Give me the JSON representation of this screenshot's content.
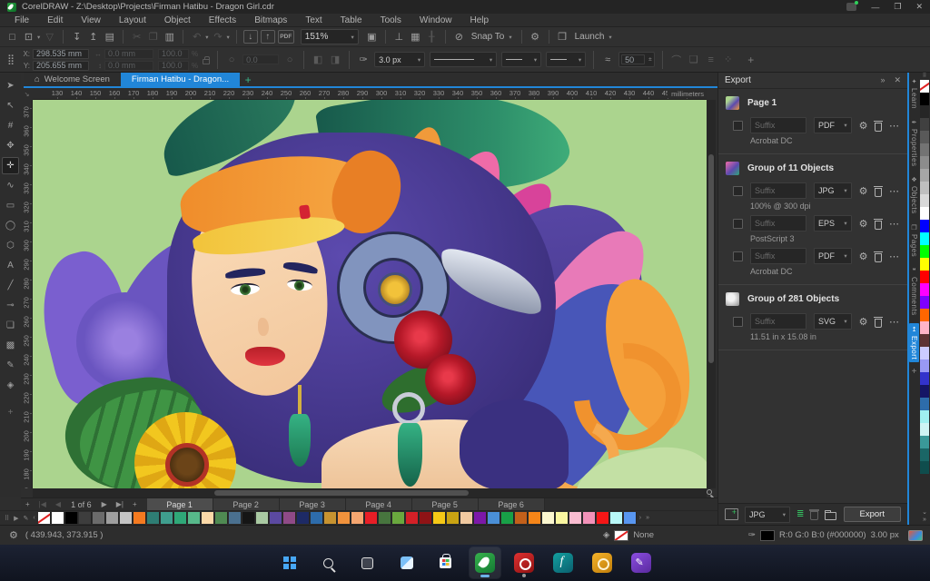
{
  "window": {
    "title": "CorelDRAW - Z:\\Desktop\\Projects\\Firman Hatibu - Dragon Girl.cdr",
    "controls": {
      "minimize": "—",
      "restore": "❐",
      "close": "✕"
    }
  },
  "menu": {
    "items": [
      "File",
      "Edit",
      "View",
      "Layout",
      "Object",
      "Effects",
      "Bitmaps",
      "Text",
      "Table",
      "Tools",
      "Window",
      "Help"
    ]
  },
  "toolbar": {
    "zoom_level": "151%",
    "items": [
      {
        "t": "icon",
        "name": "new-document-icon",
        "g": "□"
      },
      {
        "t": "icon",
        "name": "open-icon",
        "g": "⊡",
        "dd": true
      },
      {
        "t": "icon",
        "name": "save-icon",
        "g": "▽",
        "off": true
      },
      {
        "t": "sep"
      },
      {
        "t": "icon",
        "name": "get-more-download-icon",
        "g": "↧"
      },
      {
        "t": "icon",
        "name": "share-upload-icon",
        "g": "↥"
      },
      {
        "t": "icon",
        "name": "print-icon",
        "g": "▤"
      },
      {
        "t": "sep"
      },
      {
        "t": "icon",
        "name": "cut-icon",
        "g": "✂",
        "off": true
      },
      {
        "t": "icon",
        "name": "copy-icon",
        "g": "❐",
        "off": true
      },
      {
        "t": "icon",
        "name": "paste-icon",
        "g": "▥"
      },
      {
        "t": "sep"
      },
      {
        "t": "icon",
        "name": "undo-icon",
        "g": "↶",
        "off": true,
        "dd": true
      },
      {
        "t": "icon",
        "name": "redo-icon",
        "g": "↷",
        "off": true,
        "dd": true
      },
      {
        "t": "sep"
      },
      {
        "t": "icon",
        "name": "import-icon",
        "g": "↓",
        "box": true
      },
      {
        "t": "icon",
        "name": "export-icon",
        "g": "↑",
        "box": true
      },
      {
        "t": "icon",
        "name": "publish-pdf-icon",
        "g": "PDF",
        "pdf": true
      },
      {
        "t": "zoom"
      },
      {
        "t": "icon",
        "name": "fullscreen-preview-icon",
        "g": "▣"
      },
      {
        "t": "sep"
      },
      {
        "t": "icon",
        "name": "show-rulers-icon",
        "g": "⊥"
      },
      {
        "t": "icon",
        "name": "show-grid-icon",
        "g": "▦"
      },
      {
        "t": "icon",
        "name": "show-guidelines-icon",
        "g": "╂",
        "off": true
      },
      {
        "t": "sep"
      },
      {
        "t": "icon",
        "name": "snap-off-icon",
        "g": "⊘"
      },
      {
        "t": "label",
        "name": "snap-to-dropdown",
        "label": "Snap To",
        "dd": true
      },
      {
        "t": "sep"
      },
      {
        "t": "icon",
        "name": "options-gear-icon",
        "g": "⚙"
      },
      {
        "t": "sep"
      },
      {
        "t": "icon",
        "name": "launch-window-icon",
        "g": "❒"
      },
      {
        "t": "label",
        "name": "launch-dropdown",
        "label": "Launch",
        "dd": true
      }
    ]
  },
  "property_bar": {
    "x_label": "X:",
    "y_label": "Y:",
    "x": "298.535 mm",
    "y": "205.655 mm",
    "width": "0.0 mm",
    "height": "0.0 mm",
    "scale_x": "100.0",
    "scale_y": "100.0",
    "percent": "%",
    "angle": "0.0",
    "outline_width": "3.0 px",
    "smooth_steps": "50"
  },
  "document_tabs": {
    "welcome": "Welcome Screen",
    "active": "Firman Hatibu - Dragon...",
    "new_tab": "+",
    "home_icon": "⌂"
  },
  "rulers": {
    "unit": "millimeters",
    "h_start": 130,
    "h_end": 460,
    "v_start": 370,
    "v_end": 170,
    "step": 10
  },
  "toolbox": {
    "tools": [
      {
        "name": "pick-tool",
        "g": "➤"
      },
      {
        "name": "shape-tool",
        "g": "↖"
      },
      {
        "name": "crop-tool",
        "g": "#"
      },
      {
        "name": "pan-tool",
        "g": "✥"
      },
      {
        "name": "freehand-pick-tool",
        "g": "✛",
        "active": true
      },
      {
        "name": "curve-tool",
        "g": "∿"
      },
      {
        "name": "rectangle-tool",
        "g": "▭"
      },
      {
        "name": "ellipse-tool",
        "g": "◯"
      },
      {
        "name": "polygon-tool",
        "g": "⬡"
      },
      {
        "name": "text-tool",
        "g": "A"
      },
      {
        "name": "dimension-tool",
        "g": "╱"
      },
      {
        "name": "connector-tool",
        "g": "⊸"
      },
      {
        "name": "drop-shadow-tool",
        "g": "❏"
      },
      {
        "name": "transparency-tool",
        "g": "▩"
      },
      {
        "name": "eyedropper-tool",
        "g": "✎"
      },
      {
        "name": "interactive-fill-tool",
        "g": "◈"
      },
      {
        "name": "add-tool",
        "g": "+"
      }
    ]
  },
  "export_docker": {
    "title": "Export",
    "collapse_icon": "»",
    "close_icon": "✕",
    "suffix_placeholder": "Suffix",
    "groups": [
      {
        "name": "Page 1",
        "items": [
          {
            "format": "PDF",
            "detail": "Acrobat DC"
          }
        ]
      },
      {
        "name": "Group of 11 Objects",
        "items": [
          {
            "format": "JPG",
            "detail": "100% @ 300 dpi"
          },
          {
            "format": "EPS",
            "detail": "PostScript 3"
          },
          {
            "format": "PDF",
            "detail": "Acrobat DC"
          }
        ]
      },
      {
        "name": "Group of 281 Objects",
        "items": [
          {
            "format": "SVG",
            "detail": "11.51 in x 15.08 in"
          }
        ]
      }
    ],
    "footer": {
      "format": "JPG",
      "export_label": "Export"
    }
  },
  "docker_tabs": {
    "items": [
      {
        "label": "Learn",
        "icon": "✦"
      },
      {
        "label": "Properties",
        "icon": "✒"
      },
      {
        "label": "Objects",
        "icon": "❖"
      },
      {
        "label": "Pages",
        "icon": "❐"
      },
      {
        "label": "Comments",
        "icon": "❝"
      },
      {
        "label": "Export",
        "icon": "↥",
        "active": true
      }
    ],
    "add": "+"
  },
  "page_nav": {
    "add": "+",
    "first": "|◀",
    "prev": "◀",
    "counter": "1 of 6",
    "next": "▶",
    "last": "▶|",
    "add2": "+",
    "pages": [
      "Page 1",
      "Page 2",
      "Page 3",
      "Page 4",
      "Page 5",
      "Page 6"
    ],
    "active_index": 0
  },
  "palettes": {
    "document_controls": {
      "handle": "⠿",
      "flyout": "▶",
      "eyedropper": "✎",
      "scroll_left": "‹",
      "scroll_right": "›",
      "more": "»"
    },
    "document": [
      "none",
      "#ffffff",
      "#000000",
      "#3d3d3d",
      "#6b6b6b",
      "#9e9e9e",
      "#c4c4c4",
      "#f47a20",
      "#2e7d74",
      "#3f9e8e",
      "#2fa878",
      "#57b88a",
      "#fcd9a8",
      "#4f8a52",
      "#4a708f",
      "#151515",
      "#a9c9a2",
      "#5b49a0",
      "#8f4a87",
      "#1d2a66",
      "#2d6cab",
      "#c79330",
      "#f0923c",
      "#f5a670",
      "#e81e26",
      "#47753e",
      "#6aa83e",
      "#d42027",
      "#8f1315",
      "#f5c816",
      "#c9a312",
      "#f0c9a0",
      "#7c18a8",
      "#4a8fd6",
      "#18a047",
      "#c2601a",
      "#f58518",
      "#fbf7cf",
      "#f9f6a0",
      "#f9bcd0",
      "#f291b8",
      "#f51616",
      "#b8f8f8",
      "#5896f0"
    ],
    "default_controls": {
      "handle": "⠿",
      "scroll_down": "⌄",
      "more": "»"
    },
    "default": [
      "none",
      "#000000",
      "#262626",
      "#404040",
      "#595959",
      "#737373",
      "#8c8c8c",
      "#a6a6a6",
      "#bfbfbf",
      "#d9d9d9",
      "#ffffff",
      "#0000ff",
      "#00ffff",
      "#00ff00",
      "#ffff00",
      "#ff0000",
      "#ff00ff",
      "#7f00ff",
      "#ff6600",
      "#ffb4c8",
      "#5e3434",
      "#ccccff",
      "#9999f5",
      "#3333cc",
      "#151566",
      "#2d6cab",
      "#a0f0f0",
      "#cef4f4",
      "#3a9999",
      "#1a6666",
      "#0f4d4d"
    ]
  },
  "status_bar": {
    "coords": "( 439.943, 373.915 )",
    "fill_label": "None",
    "outline_color": "R:0 G:0 B:0 (#000000)",
    "outline_width": "3.00 px"
  },
  "taskbar": {
    "icons": [
      {
        "name": "start"
      },
      {
        "name": "search"
      },
      {
        "name": "task-view"
      },
      {
        "name": "widgets"
      },
      {
        "name": "store"
      },
      {
        "name": "coreldraw",
        "active": true
      },
      {
        "name": "photo-paint",
        "running": true
      },
      {
        "name": "font-manager"
      },
      {
        "name": "capture"
      },
      {
        "name": "vector"
      }
    ]
  },
  "canvas": {
    "artwork_alt": "Dragon Girl vector illustration"
  }
}
